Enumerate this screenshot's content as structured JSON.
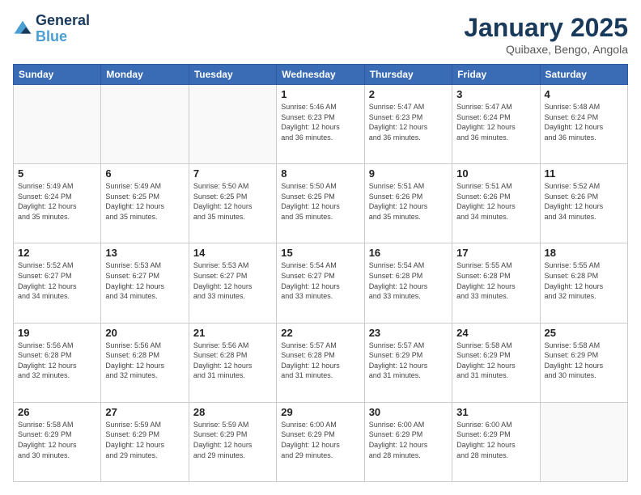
{
  "header": {
    "logo_line1": "General",
    "logo_line2": "Blue",
    "month_title": "January 2025",
    "location": "Quibaxe, Bengo, Angola"
  },
  "days_of_week": [
    "Sunday",
    "Monday",
    "Tuesday",
    "Wednesday",
    "Thursday",
    "Friday",
    "Saturday"
  ],
  "weeks": [
    [
      {
        "day": "",
        "info": ""
      },
      {
        "day": "",
        "info": ""
      },
      {
        "day": "",
        "info": ""
      },
      {
        "day": "1",
        "info": "Sunrise: 5:46 AM\nSunset: 6:23 PM\nDaylight: 12 hours\nand 36 minutes."
      },
      {
        "day": "2",
        "info": "Sunrise: 5:47 AM\nSunset: 6:23 PM\nDaylight: 12 hours\nand 36 minutes."
      },
      {
        "day": "3",
        "info": "Sunrise: 5:47 AM\nSunset: 6:24 PM\nDaylight: 12 hours\nand 36 minutes."
      },
      {
        "day": "4",
        "info": "Sunrise: 5:48 AM\nSunset: 6:24 PM\nDaylight: 12 hours\nand 36 minutes."
      }
    ],
    [
      {
        "day": "5",
        "info": "Sunrise: 5:49 AM\nSunset: 6:24 PM\nDaylight: 12 hours\nand 35 minutes."
      },
      {
        "day": "6",
        "info": "Sunrise: 5:49 AM\nSunset: 6:25 PM\nDaylight: 12 hours\nand 35 minutes."
      },
      {
        "day": "7",
        "info": "Sunrise: 5:50 AM\nSunset: 6:25 PM\nDaylight: 12 hours\nand 35 minutes."
      },
      {
        "day": "8",
        "info": "Sunrise: 5:50 AM\nSunset: 6:25 PM\nDaylight: 12 hours\nand 35 minutes."
      },
      {
        "day": "9",
        "info": "Sunrise: 5:51 AM\nSunset: 6:26 PM\nDaylight: 12 hours\nand 35 minutes."
      },
      {
        "day": "10",
        "info": "Sunrise: 5:51 AM\nSunset: 6:26 PM\nDaylight: 12 hours\nand 34 minutes."
      },
      {
        "day": "11",
        "info": "Sunrise: 5:52 AM\nSunset: 6:26 PM\nDaylight: 12 hours\nand 34 minutes."
      }
    ],
    [
      {
        "day": "12",
        "info": "Sunrise: 5:52 AM\nSunset: 6:27 PM\nDaylight: 12 hours\nand 34 minutes."
      },
      {
        "day": "13",
        "info": "Sunrise: 5:53 AM\nSunset: 6:27 PM\nDaylight: 12 hours\nand 34 minutes."
      },
      {
        "day": "14",
        "info": "Sunrise: 5:53 AM\nSunset: 6:27 PM\nDaylight: 12 hours\nand 33 minutes."
      },
      {
        "day": "15",
        "info": "Sunrise: 5:54 AM\nSunset: 6:27 PM\nDaylight: 12 hours\nand 33 minutes."
      },
      {
        "day": "16",
        "info": "Sunrise: 5:54 AM\nSunset: 6:28 PM\nDaylight: 12 hours\nand 33 minutes."
      },
      {
        "day": "17",
        "info": "Sunrise: 5:55 AM\nSunset: 6:28 PM\nDaylight: 12 hours\nand 33 minutes."
      },
      {
        "day": "18",
        "info": "Sunrise: 5:55 AM\nSunset: 6:28 PM\nDaylight: 12 hours\nand 32 minutes."
      }
    ],
    [
      {
        "day": "19",
        "info": "Sunrise: 5:56 AM\nSunset: 6:28 PM\nDaylight: 12 hours\nand 32 minutes."
      },
      {
        "day": "20",
        "info": "Sunrise: 5:56 AM\nSunset: 6:28 PM\nDaylight: 12 hours\nand 32 minutes."
      },
      {
        "day": "21",
        "info": "Sunrise: 5:56 AM\nSunset: 6:28 PM\nDaylight: 12 hours\nand 31 minutes."
      },
      {
        "day": "22",
        "info": "Sunrise: 5:57 AM\nSunset: 6:28 PM\nDaylight: 12 hours\nand 31 minutes."
      },
      {
        "day": "23",
        "info": "Sunrise: 5:57 AM\nSunset: 6:29 PM\nDaylight: 12 hours\nand 31 minutes."
      },
      {
        "day": "24",
        "info": "Sunrise: 5:58 AM\nSunset: 6:29 PM\nDaylight: 12 hours\nand 31 minutes."
      },
      {
        "day": "25",
        "info": "Sunrise: 5:58 AM\nSunset: 6:29 PM\nDaylight: 12 hours\nand 30 minutes."
      }
    ],
    [
      {
        "day": "26",
        "info": "Sunrise: 5:58 AM\nSunset: 6:29 PM\nDaylight: 12 hours\nand 30 minutes."
      },
      {
        "day": "27",
        "info": "Sunrise: 5:59 AM\nSunset: 6:29 PM\nDaylight: 12 hours\nand 29 minutes."
      },
      {
        "day": "28",
        "info": "Sunrise: 5:59 AM\nSunset: 6:29 PM\nDaylight: 12 hours\nand 29 minutes."
      },
      {
        "day": "29",
        "info": "Sunrise: 6:00 AM\nSunset: 6:29 PM\nDaylight: 12 hours\nand 29 minutes."
      },
      {
        "day": "30",
        "info": "Sunrise: 6:00 AM\nSunset: 6:29 PM\nDaylight: 12 hours\nand 28 minutes."
      },
      {
        "day": "31",
        "info": "Sunrise: 6:00 AM\nSunset: 6:29 PM\nDaylight: 12 hours\nand 28 minutes."
      },
      {
        "day": "",
        "info": ""
      }
    ]
  ]
}
